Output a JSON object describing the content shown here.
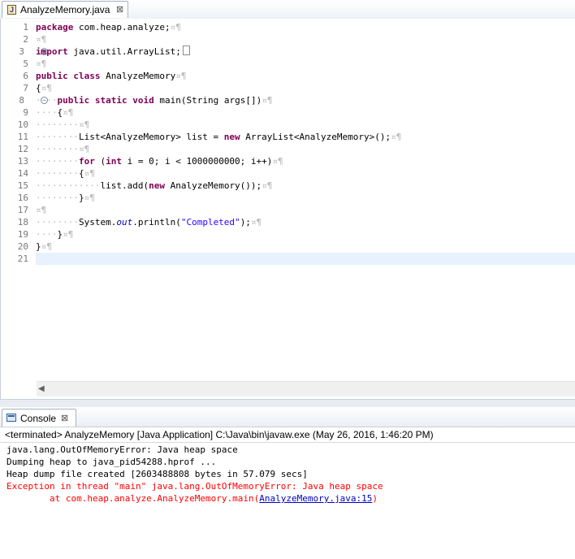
{
  "editor": {
    "tab_label": "AnalyzeMemory.java",
    "tab_icon": "java-file-icon",
    "close_symbol": "⊠",
    "line_numbers": [
      "1",
      "2",
      "3",
      "5",
      "6",
      "7",
      "8",
      "9",
      "10",
      "11",
      "12",
      "13",
      "14",
      "15",
      "16",
      "17",
      "18",
      "19",
      "20",
      "21"
    ],
    "lines": {
      "l1_kw": "package",
      "l1_rest": " com.heap.analyze;",
      "l3_kw": "import",
      "l3_rest": " java.util.ArrayList;",
      "l5_kw1": "public",
      "l5_kw2": "class",
      "l5_rest": " AnalyzeMemory",
      "l6": "{",
      "l7_kw1": "public",
      "l7_kw2": "static",
      "l7_kw3": "void",
      "l7_rest": " main(String args[])",
      "l8": "{",
      "l10_a": "List<AnalyzeMemory> list = ",
      "l10_kw": "new",
      "l10_b": " ArrayList<AnalyzeMemory>();",
      "l12_kw1": "for",
      "l12_a": " (",
      "l12_kw2": "int",
      "l12_b": " i = 0; i < 1000000000; i++)",
      "l13": "{",
      "l14_a": "list.add(",
      "l14_kw": "new",
      "l14_b": " AnalyzeMemory());",
      "l15": "}",
      "l17_a": "System.",
      "l17_out": "out",
      "l17_b": ".println(",
      "l17_str": "\"Completed\"",
      "l17_c": ");",
      "l18": "}",
      "l19": "}",
      "pilcrow": "¤¶"
    },
    "colors": {
      "keyword": "#7f0055",
      "string": "#2a00ff",
      "field": "#0000c0",
      "current_line": "#e8f2fe"
    }
  },
  "console": {
    "tab_label": "Console",
    "close_symbol": "⊠",
    "header": "<terminated> AnalyzeMemory [Java Application] C:\\Java\\bin\\javaw.exe (May 26, 2016, 1:46:20 PM)",
    "output": [
      "java.lang.OutOfMemoryError: Java heap space",
      "Dumping heap to java_pid54288.hprof ...",
      "Heap dump file created [2603488808 bytes in 57.079 secs]"
    ],
    "error_line": "Exception in thread \"main\" java.lang.OutOfMemoryError: Java heap space",
    "trace_prefix": "        at com.heap.analyze.AnalyzeMemory.main(",
    "trace_link": "AnalyzeMemory.java:15",
    "trace_suffix": ")",
    "colors": {
      "error": "#ff0000",
      "link": "#0000c0"
    }
  }
}
